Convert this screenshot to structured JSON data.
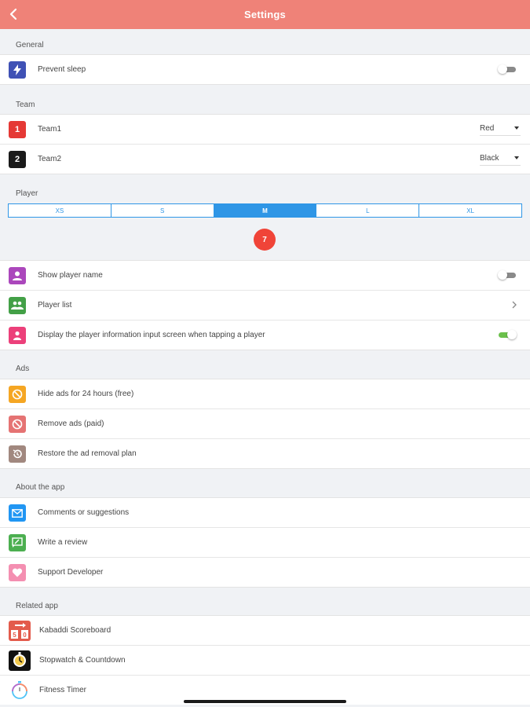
{
  "header": {
    "title": "Settings"
  },
  "general": {
    "label": "General",
    "prevent_sleep": {
      "label": "Prevent sleep",
      "on": false
    }
  },
  "team": {
    "label": "Team",
    "items": [
      {
        "num": "1",
        "label": "Team1",
        "color": "Red",
        "icon_color": "#e53935"
      },
      {
        "num": "2",
        "label": "Team2",
        "color": "Black",
        "icon_color": "#1a1a1a"
      }
    ]
  },
  "player": {
    "label": "Player",
    "sizes": [
      "XS",
      "S",
      "M",
      "L",
      "XL"
    ],
    "selected_size": "M",
    "badge": "7",
    "show_name": {
      "label": "Show player name",
      "on": false
    },
    "list": {
      "label": "Player list"
    },
    "display_input": {
      "label": "Display the player information input screen when tapping a player",
      "on": true
    }
  },
  "ads": {
    "label": "Ads",
    "items": [
      {
        "label": "Hide ads for 24 hours (free)",
        "icon": "no-ads-icon",
        "color": "#f5a623"
      },
      {
        "label": "Remove ads (paid)",
        "icon": "no-ads-icon",
        "color": "#e57373"
      },
      {
        "label": "Restore the ad removal plan",
        "icon": "restore-icon",
        "color": "#a1887f"
      }
    ]
  },
  "about": {
    "label": "About the app",
    "items": [
      {
        "label": "Comments or suggestions",
        "icon": "mail-icon",
        "color": "#2196f3"
      },
      {
        "label": "Write a review",
        "icon": "review-icon",
        "color": "#4caf50"
      },
      {
        "label": "Support Developer",
        "icon": "heart-icon",
        "color": "#f48fb1"
      }
    ]
  },
  "related": {
    "label": "Related app",
    "items": [
      {
        "label": "Kabaddi Scoreboard",
        "icon": "kabaddi-scoreboard-icon"
      },
      {
        "label": "Stopwatch & Countdown",
        "icon": "stopwatch-icon"
      },
      {
        "label": "Fitness Timer",
        "icon": "fitness-timer-icon"
      }
    ]
  }
}
